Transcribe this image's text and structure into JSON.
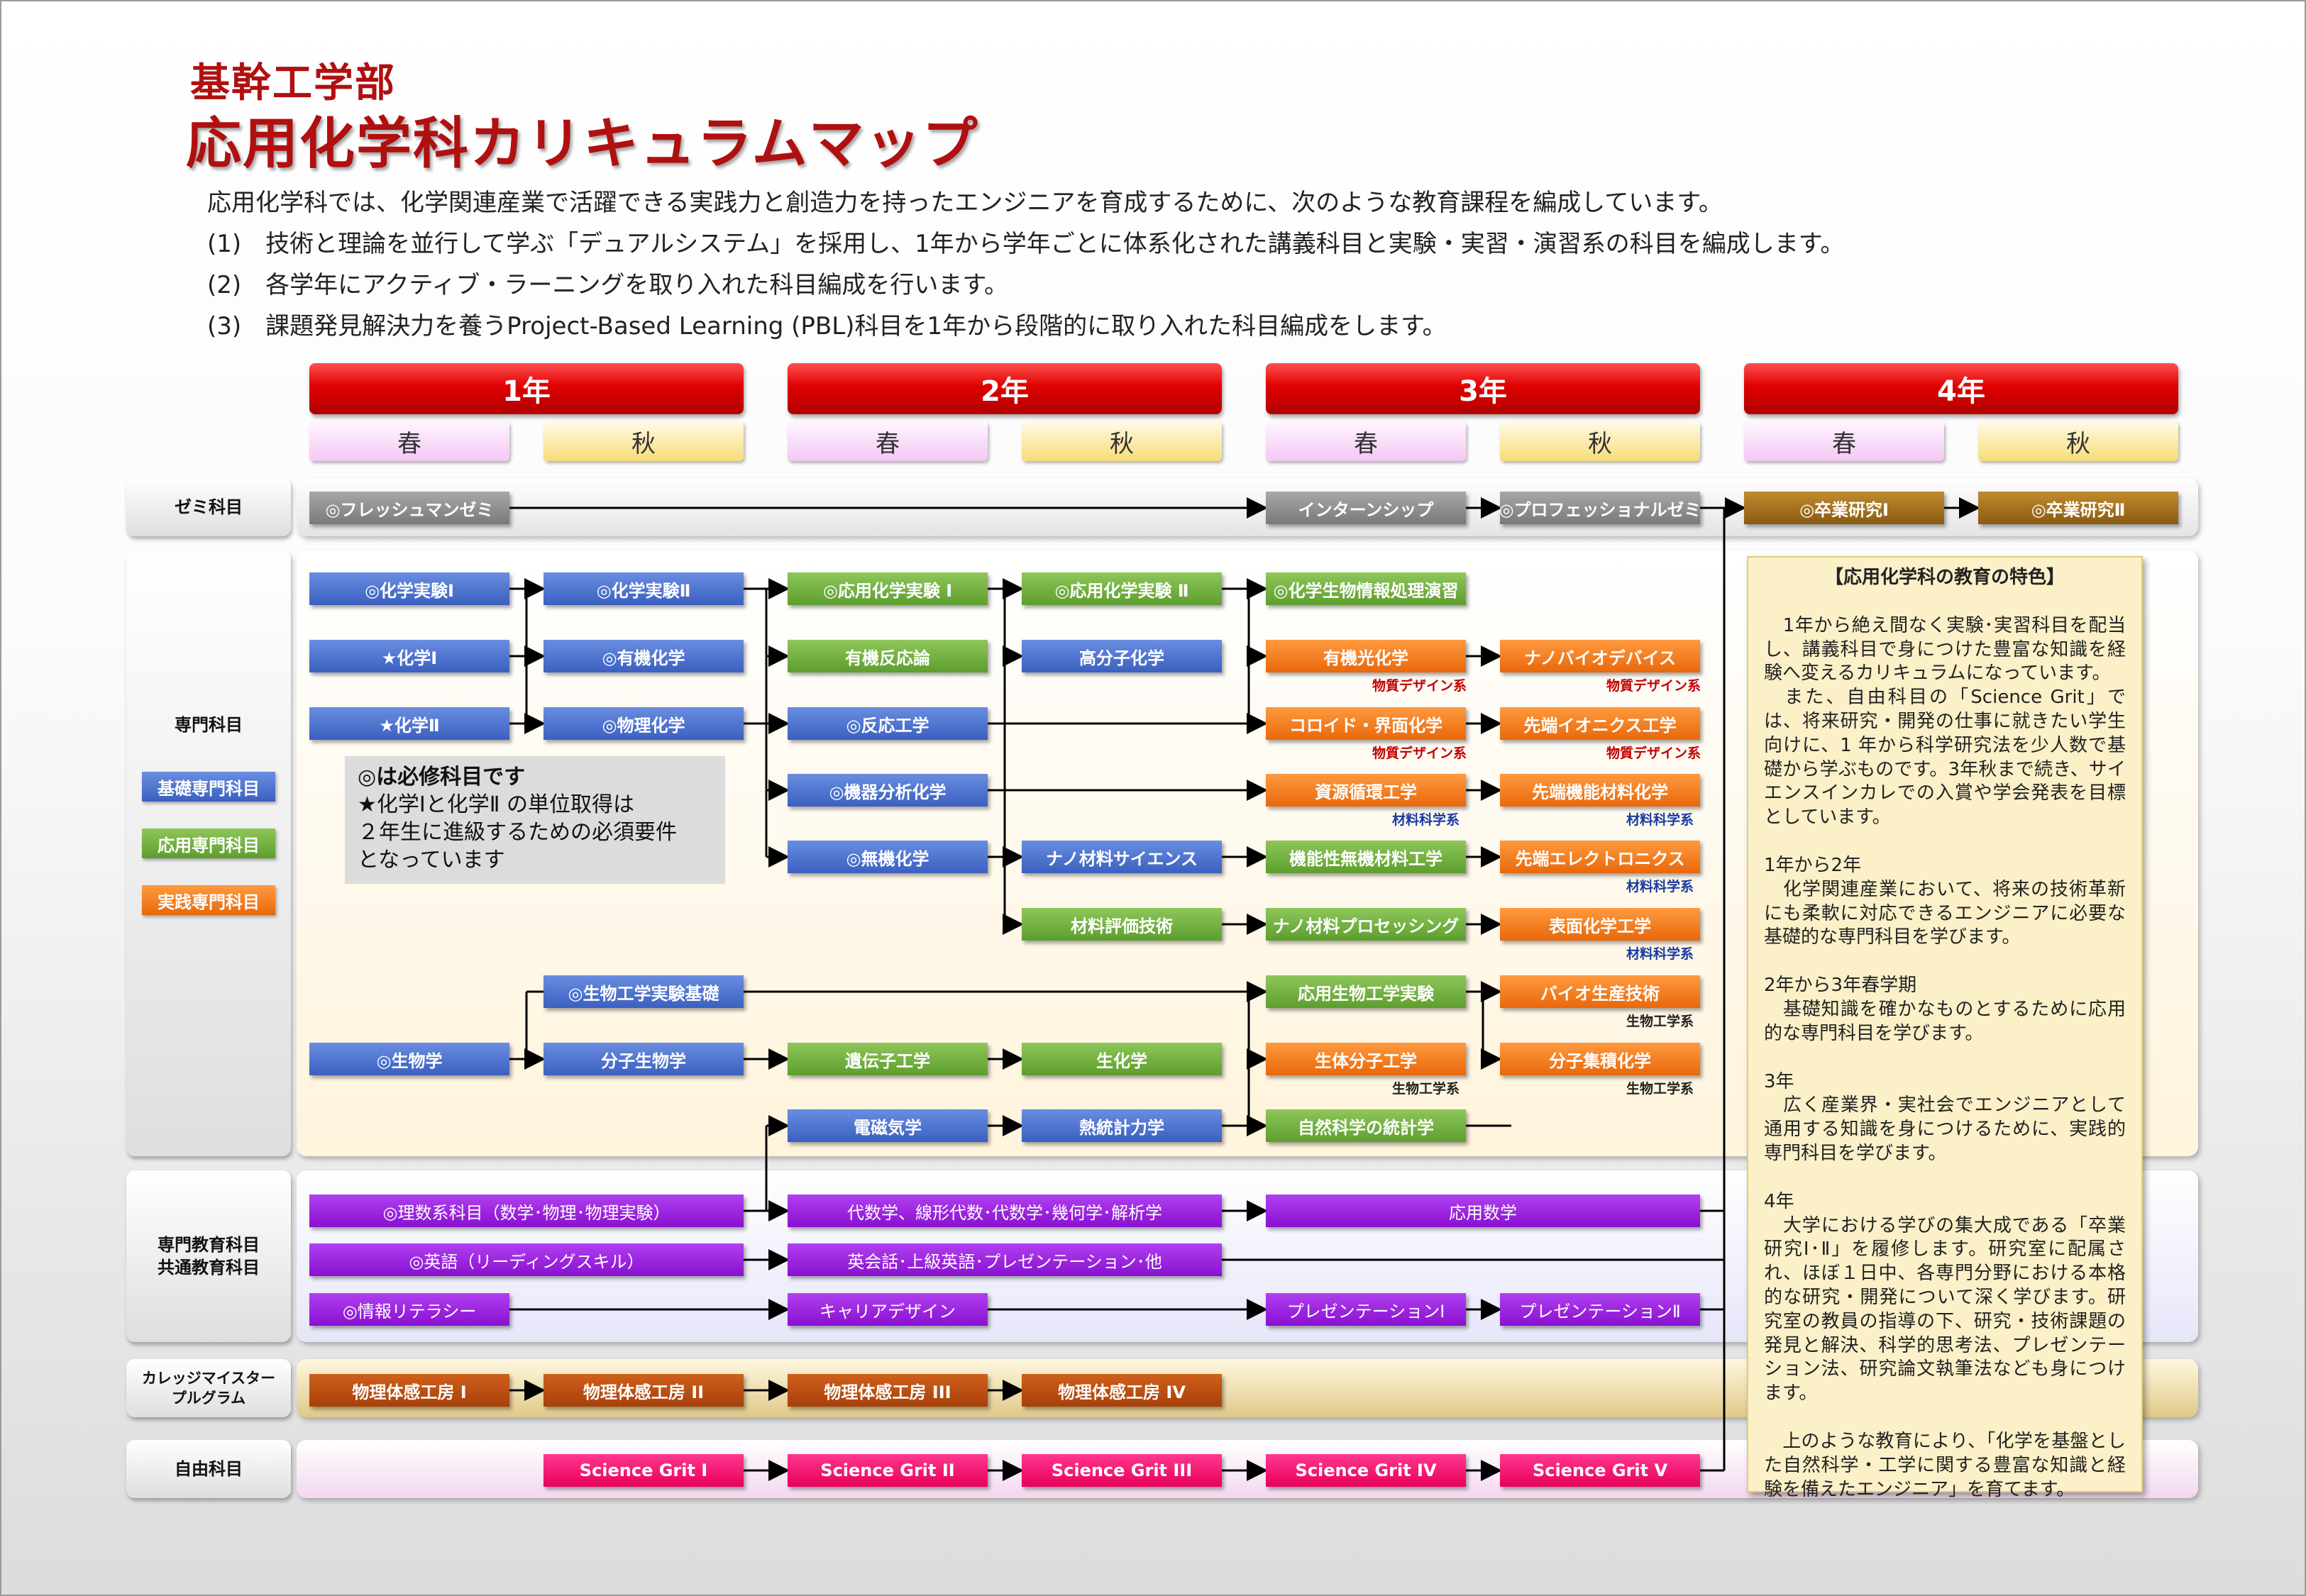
{
  "title": {
    "faculty": "基幹工学部",
    "main": "応用化学科カリキュラムマップ"
  },
  "intro": [
    "応用化学科では、化学関連産業で活躍できる実践力と創造力を持ったエンジニアを育成するために、次のような教育課程を編成しています。",
    "(1)　技術と理論を並行して学ぶ「デュアルシステム」を採用し、1年から学年ごとに体系化された講義科目と実験・実習・演習系の科目を編成します。",
    "(2)　各学年にアクティブ・ラーニングを取り入れた科目編成を行います。",
    "(3)　課題発見解決力を養うProject-Based Learning (PBL)科目を1年から段階的に取り入れた科目編成をします。"
  ],
  "years": [
    "1年",
    "2年",
    "3年",
    "4年"
  ],
  "semesters": {
    "spring": "春",
    "autumn": "秋"
  },
  "rows": {
    "seminar": "ゼミ科目",
    "specialized": "専門科目",
    "common": [
      "専門教育科目",
      "共通教育科目"
    ],
    "college": [
      "カレッジマイスター",
      "プルグラム"
    ],
    "free": "自由科目"
  },
  "legend": {
    "basic": "基礎専門科目",
    "applied": "応用専門科目",
    "practical": "実践専門科目"
  },
  "note": [
    "◎は必修科目です",
    "★化学Ⅰと化学Ⅱ の単位取得は",
    "２年生に進級するための必須要件",
    "となっています"
  ],
  "courses": {
    "seminar": [
      "◎フレッシュマンゼミ",
      "インターンシップ",
      "◎プロフェッショナルゼミ",
      "◎卒業研究Ⅰ",
      "◎卒業研究Ⅱ"
    ],
    "y1s": [
      "◎化学実験Ⅰ",
      "★化学Ⅰ",
      "★化学Ⅱ",
      "◎生物学"
    ],
    "y1a": [
      "◎化学実験Ⅱ",
      "◎有機化学",
      "◎物理化学",
      "◎生物工学実験基礎",
      "分子生物学"
    ],
    "y2s": [
      "◎応用化学実験 Ⅰ",
      "有機反応論",
      "◎反応工学",
      "◎機器分析化学",
      "◎無機化学",
      "遺伝子工学",
      "電磁気学"
    ],
    "y2a": [
      "◎応用化学実験 Ⅱ",
      "高分子化学",
      "ナノ材料サイエンス",
      "材料評価技術",
      "生化学",
      "熱統計力学"
    ],
    "y3s": [
      "◎化学生物情報処理演習",
      "有機光化学",
      "コロイド・界面化学",
      "資源循環工学",
      "機能性無機材料工学",
      "ナノ材料プロセッシング",
      "応用生物工学実験",
      "生体分子工学",
      "自然科学の統計学"
    ],
    "y3a": [
      "ナノバイオデバイス",
      "先端イオニクス工学",
      "先端機能材料化学",
      "先端エレクトロニクス",
      "表面化学工学",
      "バイオ生産技術",
      "分子集積化学"
    ],
    "common": [
      "◎理数系科目（数学･物理･物理実験）",
      "◎英語（リーディングスキル）",
      "◎情報リテラシー",
      "代数学、線形代数･代数学･幾何学･解析学",
      "英会話･上級英語･プレゼンテーション･他",
      "キャリアデザイン",
      "応用数学",
      "プレゼンテーションⅠ",
      "プレゼンテーションⅡ"
    ],
    "college": [
      "物理体感工房 Ⅰ",
      "物理体感工房 II",
      "物理体感工房 III",
      "物理体感工房 IV"
    ],
    "free": [
      "Science Grit I",
      "Science Grit II",
      "Science Grit III",
      "Science Grit IV",
      "Science Grit V"
    ]
  },
  "tags": {
    "design": "物質デザイン系",
    "material": "材料科学系",
    "bio": "生物工学系"
  },
  "features": {
    "title": "【応用化学科の教育の特色】",
    "p1": "　1年から絶え間なく実験･実習科目を配当し、講義科目で身につけた豊富な知識を経験へ変えるカリキュラムになっています。",
    "p2": "　また、自由科目の「Science Grit」では、将来研究・開発の仕事に就きたい学生向けに、1 年から科学研究法を少人数で基礎から学ぶものです。3年秋まで続き、サイエンスインカレでの入賞や学会発表を目標としています。",
    "h1": "1年から2年",
    "p3": "　化学関連産業において、将来の技術革新にも柔軟に対応できるエンジニアに必要な基礎的な専門科目を学びます。",
    "h2": "2年から3年春学期",
    "p4": "　基礎知識を確かなものとするために応用的な専門科目を学びます。",
    "h3": "3年",
    "p5": "　広く産業界・実社会でエンジニアとして通用する知識を身につけるために、実践的専門科目を学びます。",
    "h4": "4年",
    "p6": "　大学における学びの集大成である「卒業研究Ⅰ･Ⅱ」を履修します。研究室に配属され、ほぼ１日中、各専門分野における本格的な研究・開発について深く学びます。研究室の教員の指導の下、研究・技術課題の発見と解決、科学的思考法、プレゼンテーション法、研究論文執筆法なども身につけます。",
    "p7": "　上のような教育により、「化学を基盤とした自然科学・工学に関する豊富な知識と経験を備えたエンジニア」を育てます。"
  },
  "colors": {
    "basic": "#3a60c0",
    "applied": "#5d9e2e",
    "practical": "#e8680a",
    "year": "#e00000",
    "common": "#8a10d0",
    "free": "#e8005a"
  }
}
